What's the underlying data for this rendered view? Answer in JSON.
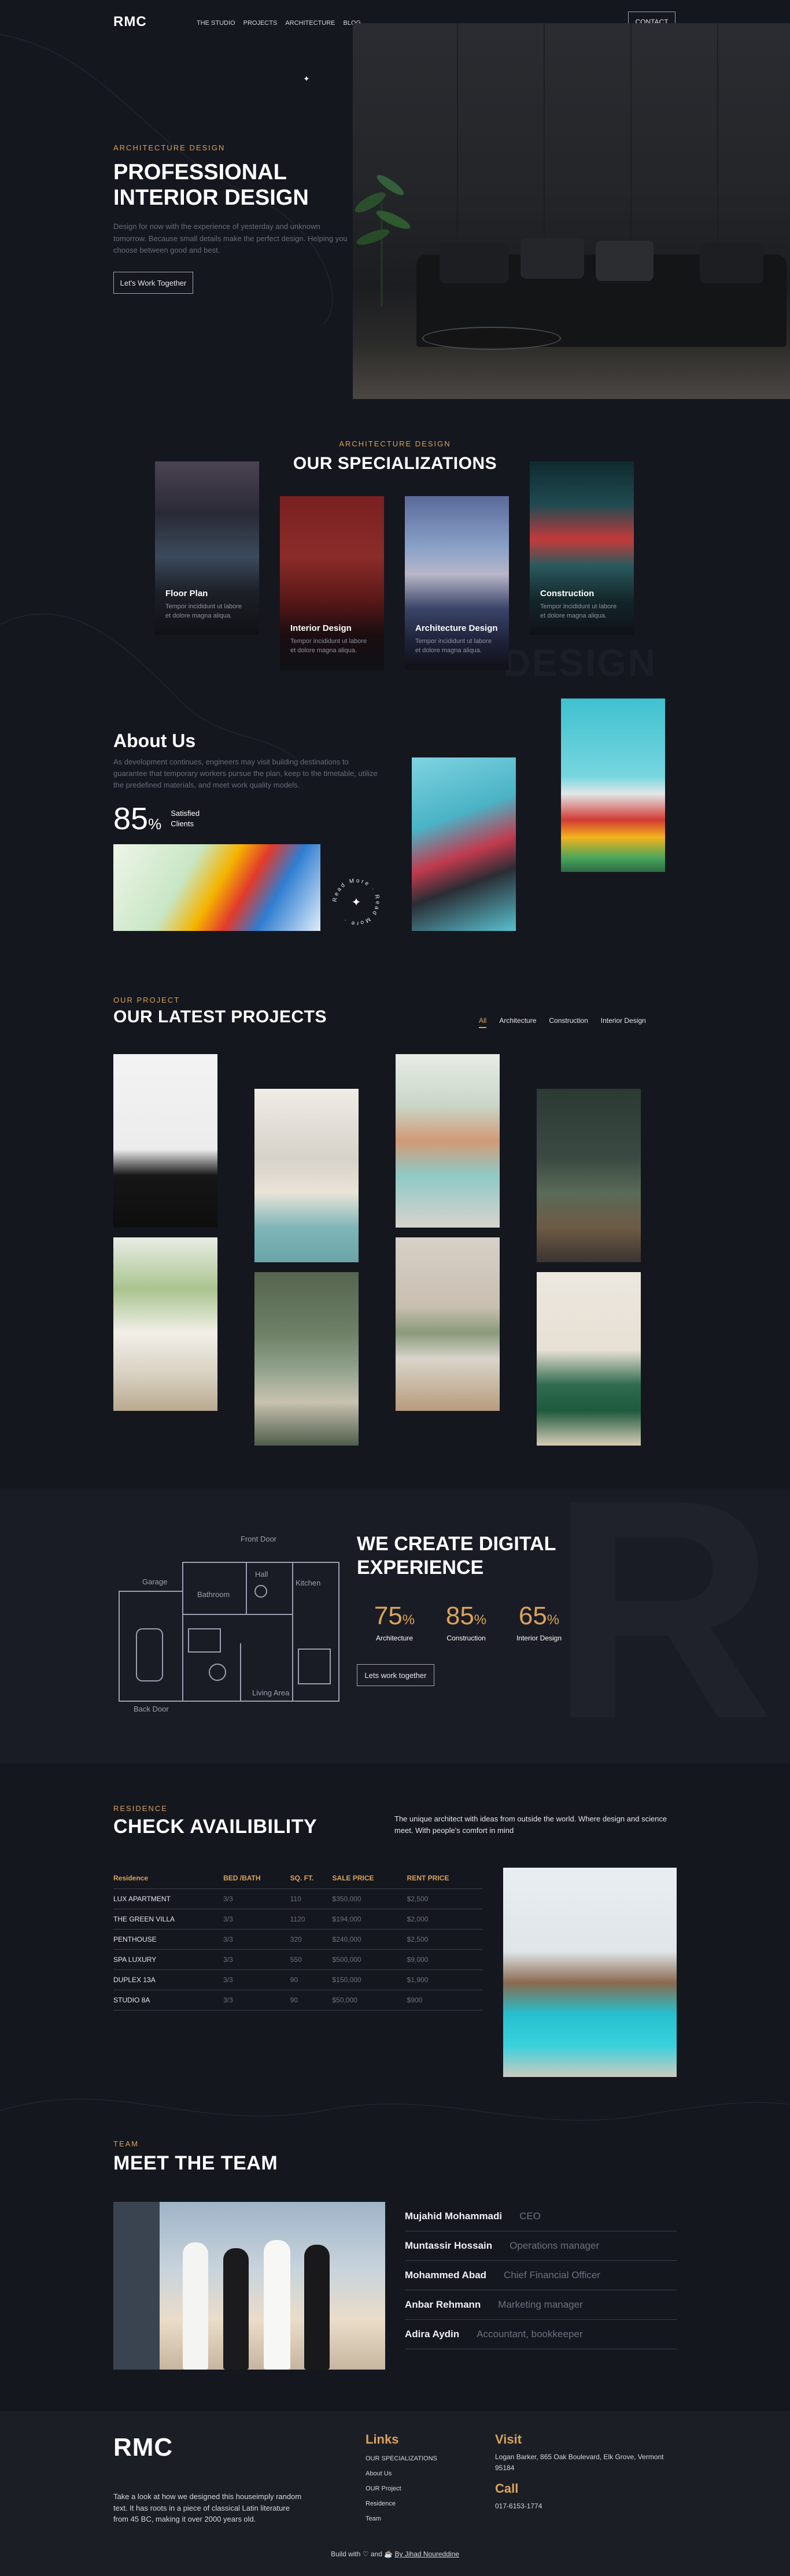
{
  "nav": {
    "logo": "RMC",
    "links": [
      "THE STUDIO",
      "PROJECTS",
      "ARCHITECTURE",
      "BLOG"
    ],
    "contact": "CONTACT"
  },
  "hero": {
    "eyebrow": "ARCHITECTURE DESIGN",
    "title_line1": "PROFESSIONAL",
    "title_line2": "INTERIOR DESIGN",
    "description": "Design for now with the experience of yesterday and unknown tomorrow. Because small details make the perfect design. Helping you choose between good and best.",
    "button": "Let's Work Together"
  },
  "specializations": {
    "eyebrow": "ARCHITECTURE DESIGN",
    "title": "OUR SPECIALIZATIONS",
    "ghost": "DESIGN",
    "cards": [
      {
        "title": "Floor Plan",
        "desc": "Tempor incididunt ut labore et dolore magna aliqua."
      },
      {
        "title": "Interior Design",
        "desc": "Tempor incididunt ut labore et dolore magna aliqua."
      },
      {
        "title": "Architecture Design",
        "desc": "Tempor incididunt ut labore et dolore magna aliqua."
      },
      {
        "title": "Construction",
        "desc": "Tempor incididunt ut labore et dolore magna aliqua."
      }
    ]
  },
  "about": {
    "title": "About Us",
    "description": "As development continues, engineers may visit building destinations to guarantee that temporary workers pursue the plan, keep to the timetable, utilize the predefined materials, and meet work quality models.",
    "stat_number": "85",
    "stat_unit": "%",
    "stat_label_line1": "Satisfied",
    "stat_label_line2": "Clients",
    "badge_text": "Read More · Read More ·"
  },
  "projects": {
    "eyebrow": "OUR PROJECT",
    "title": "OUR LATEST PROJECTS",
    "filters": [
      "All",
      "Architecture",
      "Construction",
      "Interior Design"
    ]
  },
  "digital": {
    "title_line1": "WE CREATE DIGITAL",
    "title_line2": "EXPERIENCE",
    "stats": [
      {
        "value": "75",
        "unit": "%",
        "label": "Architecture"
      },
      {
        "value": "85",
        "unit": "%",
        "label": "Construction"
      },
      {
        "value": "65",
        "unit": "%",
        "label": "Interior Design"
      }
    ],
    "button": "Lets work together",
    "floorplan_labels": [
      "Front Door",
      "Garage",
      "Bathroom",
      "Hall",
      "Kitchen",
      "Back Door",
      "Living Area"
    ]
  },
  "residence": {
    "eyebrow": "RESIDENCE",
    "title": "CHECK AVAILIBILITY",
    "note": "The unique architect with ideas from outside the world. Where design and science meet. With people's comfort in mind",
    "headers": [
      "Residence",
      "BED /BATH",
      "SQ. FT.",
      "SALE PRICE",
      "RENT PRICE"
    ],
    "rows": [
      [
        "LUX APARTMENT",
        "3/3",
        "110",
        "$350,000",
        "$2,500"
      ],
      [
        "THE GREEN VILLA",
        "3/3",
        "1120",
        "$194,000",
        "$2,000"
      ],
      [
        "PENTHOUSE",
        "3/3",
        "320",
        "$240,000",
        "$2,500"
      ],
      [
        "SPA LUXURY",
        "3/3",
        "550",
        "$500,000",
        "$9,000"
      ],
      [
        "DUPLEX 13A",
        "3/3",
        "90",
        "$150,000",
        "$1,900"
      ],
      [
        "STUDIO 8A",
        "3/3",
        "90",
        "$50,000",
        "$900"
      ]
    ]
  },
  "team": {
    "eyebrow": "TEAM",
    "title": "MEET THE TEAM",
    "members": [
      {
        "name": "Mujahid Mohammadi",
        "role": "CEO"
      },
      {
        "name": "Muntassir Hossain",
        "role": "Operations manager"
      },
      {
        "name": "Mohammed Abad",
        "role": "Chief Financial Officer"
      },
      {
        "name": "Anbar Rehmann",
        "role": "Marketing manager"
      },
      {
        "name": "Adira Aydin",
        "role": "Accountant, bookkeeper"
      }
    ]
  },
  "footer": {
    "logo": "RMC",
    "description": "Take a look at how we designed this houseimply random text. It has roots in a piece of classical Latin literature from 45 BC, making it over 2000 years old.",
    "links_title": "Links",
    "links": [
      "OUR SPECIALIZATIONS",
      "About Us",
      "OUR Project",
      "Residence",
      "Team"
    ],
    "visit_title": "Visit",
    "address": "Logan Barker, 865 Oak Boulevard, Elk Grove, Vermont 95184",
    "call_title": "Call",
    "phone": "017-6153-1774",
    "built_prefix": "Build with ♡ and ☕",
    "author": "By Jihad Noureddine"
  }
}
